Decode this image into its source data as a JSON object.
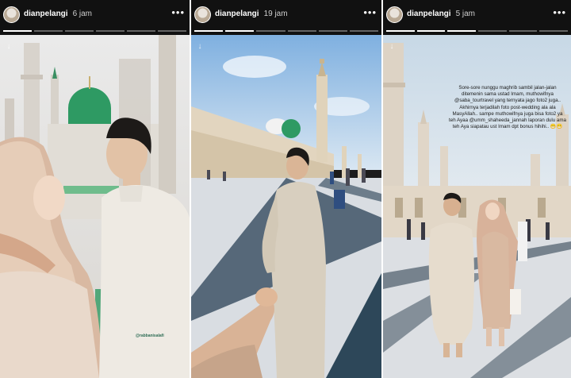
{
  "stories": [
    {
      "username": "dianpelangi",
      "time": "6 jam",
      "mention": "@rabbanisalafi"
    },
    {
      "username": "dianpelangi",
      "time": "19 jam"
    },
    {
      "username": "dianpelangi",
      "time": "5 jam",
      "caption": "Sore-sore nunggu maghrib sambil jalan-jalan ditemenin sama ustad Imam, muthowifnya @saba_tourtravel yang ternyata jago foto2 juga.. Akhirnya terjadilah foto post-wedding ala ala MasyAllah.. sampe muthowifnya juga bisa foto2 ya teh Ayaa @umm_shaheeda_jannah laporan dulu ama teh Aya siapatau ust Imam dpt bonus hihihi.. 😁😁"
    }
  ],
  "icons": {
    "more": "more-icon",
    "download": "download-icon",
    "avatar": "avatar"
  },
  "colors": {
    "topbar": "#111111",
    "dome_green": "#2e9a63",
    "sky": "#cfe3f3",
    "marble": "#e7e4df"
  }
}
